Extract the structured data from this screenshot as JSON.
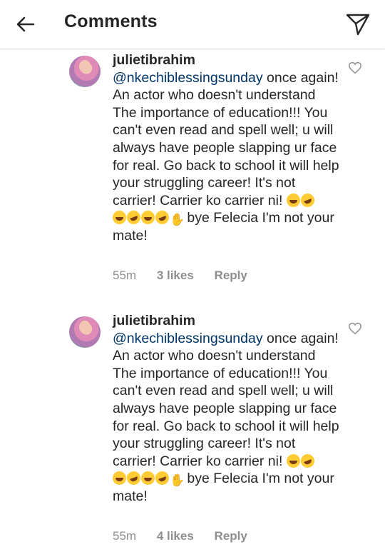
{
  "header": {
    "title": "Comments"
  },
  "comments": [
    {
      "username": "julietibrahim",
      "mention": "@nkechiblessingsunday",
      "text_main": " once again! An actor who doesn't understand The importance of education!!! You can't even read and spell well; u will always have people slapping ur face for real. Go back to school it will help your struggling career! It's not carrier! Carrier ko carrier ni! ",
      "text_tail": " bye Felecia I'm not your mate!",
      "time": "55m",
      "likes": "3 likes",
      "reply": "Reply"
    },
    {
      "username": "julietibrahim",
      "mention": "@nkechiblessingsunday",
      "text_main": " once again! An actor who doesn't understand The importance of education!!! You can't even read and spell well; u will always have people slapping ur face for real. Go back to school it will help your struggling career! It's not carrier! Carrier ko carrier ni! ",
      "text_tail": " bye Felecia I'm not your mate!",
      "time": "55m",
      "likes": "4 likes",
      "reply": "Reply"
    }
  ],
  "icons": {
    "back": "arrow-left-icon",
    "send": "send-icon",
    "like": "heart-outline-icon"
  }
}
